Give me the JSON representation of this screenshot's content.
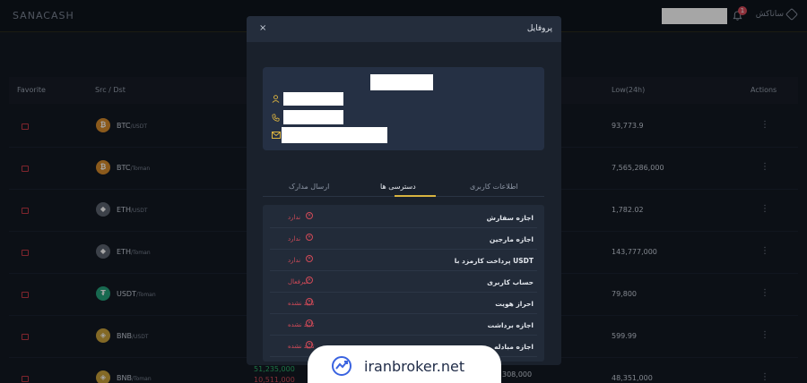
{
  "header": {
    "logo": "SANACASH",
    "brand": "ساناکش",
    "notification_count": "1"
  },
  "table": {
    "columns": {
      "favorite": "Favorite",
      "pair": "Src / Dst",
      "low": "Low(24h)",
      "actions": "Actions"
    },
    "rows": [
      {
        "coin": "BTC",
        "quote": "/USDT",
        "low": "93,773.9",
        "icon_color": "#d68a2c",
        "glyph": "₿"
      },
      {
        "coin": "BTC",
        "quote": "/Toman",
        "low": "7,565,286,000",
        "icon_color": "#d68a2c",
        "glyph": "₿"
      },
      {
        "coin": "ETH",
        "quote": "/USDT",
        "low": "1,782.02",
        "icon_color": "#5c6470",
        "glyph": "◆"
      },
      {
        "coin": "ETH",
        "quote": "/Toman",
        "low": "143,777,000",
        "icon_color": "#5c6470",
        "glyph": "◆"
      },
      {
        "coin": "USDT",
        "quote": "/Toman",
        "low": "79,800",
        "icon_color": "#26a17b",
        "glyph": "₮"
      },
      {
        "coin": "BNB",
        "quote": "/USDT",
        "low": "599.99",
        "icon_color": "#c9a13b",
        "glyph": "◈"
      },
      {
        "coin": "BNB",
        "quote": "/Toman",
        "low": "48,351,000",
        "icon_color": "#c9a13b",
        "glyph": "◈"
      }
    ],
    "below_modal_green": "51,235,000",
    "below_modal_red": "10,511,000",
    "below_modal_right": "308,000"
  },
  "modal": {
    "title": "پروفایل",
    "close": "×",
    "tabs": [
      "اطلاعات کاربری",
      "دسترسی ها",
      "ارسال مدارک"
    ],
    "active_tab": "دسترسی ها",
    "permissions": [
      {
        "label": "اجازه سفارش",
        "status": "ندارد"
      },
      {
        "label": "اجازه مارجین",
        "status": "ندارد"
      },
      {
        "label": "پرداخت کارمزد با USDT",
        "status": "ندارد"
      },
      {
        "label": "حساب کاربری",
        "status": "غیرفعال"
      },
      {
        "label": "احراز هویت",
        "status": "تایید نشده"
      },
      {
        "label": "اجازه برداشت",
        "status": "تایید نشده"
      },
      {
        "label": "اجازه مبادله",
        "status": "تایید نشده"
      }
    ]
  },
  "watermark": {
    "text": "iranbroker.net"
  },
  "colors": {
    "accent": "#d9b440",
    "danger": "#d04a58",
    "positive": "#2bb36b"
  }
}
